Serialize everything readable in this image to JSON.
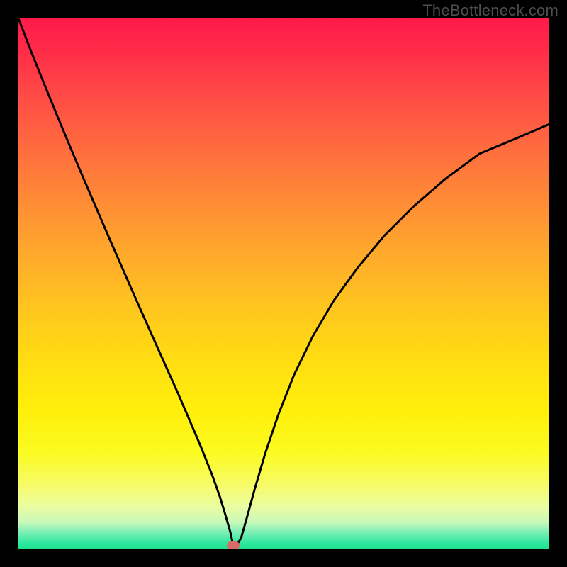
{
  "watermark": "TheBottleneck.com",
  "marker": {
    "x_frac": 0.405,
    "y_frac": 0.993
  },
  "chart_data": {
    "type": "line",
    "title": "",
    "xlabel": "",
    "ylabel": "",
    "xlim": [
      0,
      1
    ],
    "ylim": [
      0,
      1
    ],
    "series": [
      {
        "name": "curve",
        "x": [
          0.0,
          0.025,
          0.05,
          0.075,
          0.1,
          0.125,
          0.15,
          0.175,
          0.2,
          0.225,
          0.25,
          0.275,
          0.3,
          0.322,
          0.345,
          0.365,
          0.38,
          0.39,
          0.4,
          0.405,
          0.412,
          0.42,
          0.43,
          0.445,
          0.465,
          0.49,
          0.52,
          0.555,
          0.595,
          0.64,
          0.69,
          0.745,
          0.805,
          0.87,
          0.935,
          1.0
        ],
        "y": [
          1.0,
          0.935,
          0.873,
          0.812,
          0.752,
          0.693,
          0.635,
          0.577,
          0.52,
          0.463,
          0.407,
          0.351,
          0.295,
          0.244,
          0.19,
          0.14,
          0.098,
          0.065,
          0.03,
          0.007,
          0.007,
          0.02,
          0.055,
          0.11,
          0.178,
          0.252,
          0.328,
          0.4,
          0.468,
          0.53,
          0.59,
          0.645,
          0.697,
          0.745,
          0.772,
          0.8
        ]
      }
    ],
    "marker_point": {
      "x": 0.405,
      "y": 0.007
    },
    "background_gradient_stops": [
      {
        "pos": 0.0,
        "color": "#ff1a4a"
      },
      {
        "pos": 0.5,
        "color": "#ffc41f"
      },
      {
        "pos": 0.82,
        "color": "#fbfb22"
      },
      {
        "pos": 1.0,
        "color": "#1ce38f"
      }
    ]
  }
}
